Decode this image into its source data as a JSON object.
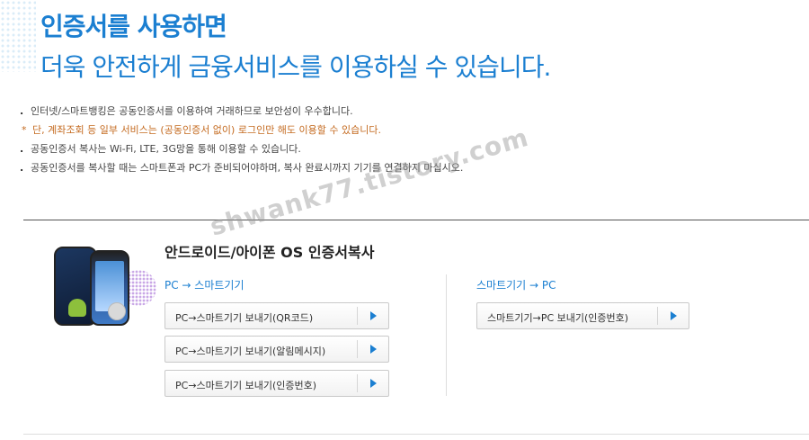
{
  "header": {
    "title_line1": "인증서를 사용하면",
    "title_line2": "더욱 안전하게 금융서비스를 이용하실 수 있습니다."
  },
  "notes": [
    {
      "bullet": ".",
      "text": "인터넷/스마트뱅킹은 공동인증서를 이용하여 거래하므로 보안성이 우수합니다."
    },
    {
      "mark": "*",
      "text": "단, 계좌조회 등 일부 서비스는 (공동인증서 없이) 로그인만 해도 이용할 수 있습니다."
    },
    {
      "bullet": ".",
      "text": "공동인증서 복사는 Wi-Fi, LTE, 3G망을 통해 이용할 수 있습니다."
    },
    {
      "bullet": ".",
      "text": "공동인증서를 복사할 때는 스마트폰과 PC가 준비되어야하며, 복사 완료시까지 기기를 연결하지 마십시오."
    }
  ],
  "watermark": "shwank77.tistory.com",
  "section": {
    "title": "안드로이드/아이폰 OS 인증서복사",
    "left_heading": "PC → 스마트기기",
    "right_heading": "스마트기기 → PC",
    "left_buttons": [
      "PC→스마트기기 보내기(QR코드)",
      "PC→스마트기기 보내기(알림메시지)",
      "PC→스마트기기 보내기(인증번호)"
    ],
    "right_buttons": [
      "스마트기기→PC 보내기(인증번호)"
    ]
  },
  "colors": {
    "accent": "#1b7fd1",
    "note_highlight": "#c46a1f"
  }
}
